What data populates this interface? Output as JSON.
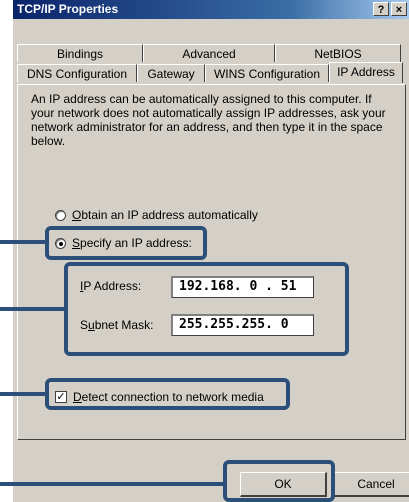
{
  "window": {
    "title": "TCP/IP Properties",
    "help_label": "?",
    "close_label": "×"
  },
  "tabs": {
    "row1": [
      "Bindings",
      "Advanced",
      "NetBIOS"
    ],
    "row2": [
      "DNS Configuration",
      "Gateway",
      "WINS Configuration",
      "IP Address"
    ],
    "active": "IP Address"
  },
  "description": "An IP address can be automatically assigned to this computer. If your network does not automatically assign IP addresses, ask your network administrator for an address, and then type it in the space below.",
  "options": {
    "obtain_auto": {
      "mnemonic": "O",
      "rest": "btain an IP address automatically",
      "selected": false
    },
    "specify": {
      "mnemonic": "S",
      "rest": "pecify an IP address:",
      "selected": true
    }
  },
  "fields": {
    "ip_label_mnemonic": "I",
    "ip_label_rest": "P Address:",
    "ip_value": "192.168. 0 . 51",
    "subnet_label_pre": "S",
    "subnet_label_mnemonic": "u",
    "subnet_label_rest": "bnet Mask:",
    "subnet_value": "255.255.255. 0"
  },
  "detect_media": {
    "mnemonic": "D",
    "rest": "etect connection to network media",
    "checked": true
  },
  "buttons": {
    "ok": "OK",
    "cancel": "Cancel"
  },
  "colors": {
    "highlight": "#2b4f78",
    "dialog": "#d4d0c8",
    "titlebar": "#0a246a"
  }
}
